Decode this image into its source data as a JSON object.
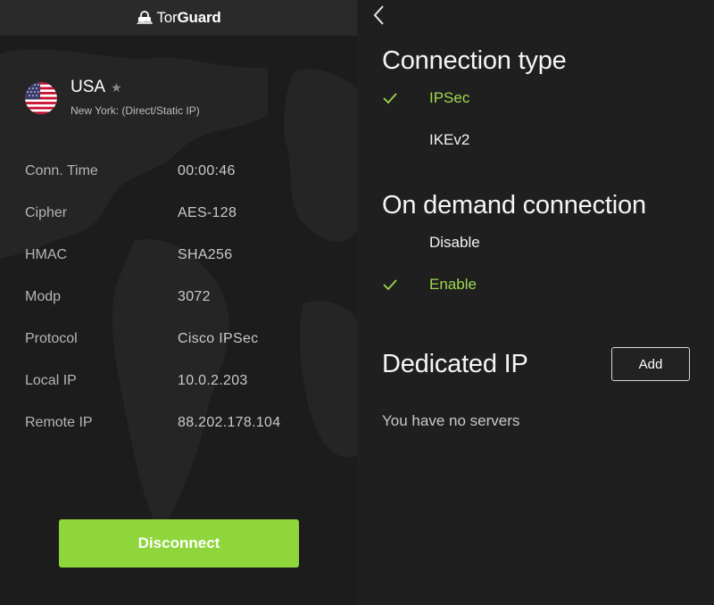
{
  "app": {
    "brand_prefix": "Tor",
    "brand_suffix": "Guard"
  },
  "server": {
    "country": "USA",
    "location": "New York: (Direct/Static IP)",
    "favorite_icon": "star-icon"
  },
  "stats": [
    {
      "label": "Conn. Time",
      "value": "00:00:46"
    },
    {
      "label": "Cipher",
      "value": "AES-128"
    },
    {
      "label": "HMAC",
      "value": "SHA256"
    },
    {
      "label": "Modp",
      "value": "3072"
    },
    {
      "label": "Protocol",
      "value": "Cisco IPSec"
    },
    {
      "label": "Local IP",
      "value": "10.0.2.203"
    },
    {
      "label": "Remote IP",
      "value": "88.202.178.104"
    }
  ],
  "disconnect_label": "Disconnect",
  "settings": {
    "connection_type": {
      "title": "Connection type",
      "options": [
        {
          "label": "IPSec",
          "selected": true
        },
        {
          "label": "IKEv2",
          "selected": false
        }
      ]
    },
    "on_demand": {
      "title": "On demand connection",
      "options": [
        {
          "label": "Disable",
          "selected": false
        },
        {
          "label": "Enable",
          "selected": true
        }
      ]
    },
    "dedicated_ip": {
      "title": "Dedicated IP",
      "add_label": "Add",
      "empty_text": "You have no servers"
    }
  },
  "colors": {
    "accent_green": "#8ed63b",
    "selected_text": "#9fd84f",
    "background": "#1f1f1f"
  }
}
